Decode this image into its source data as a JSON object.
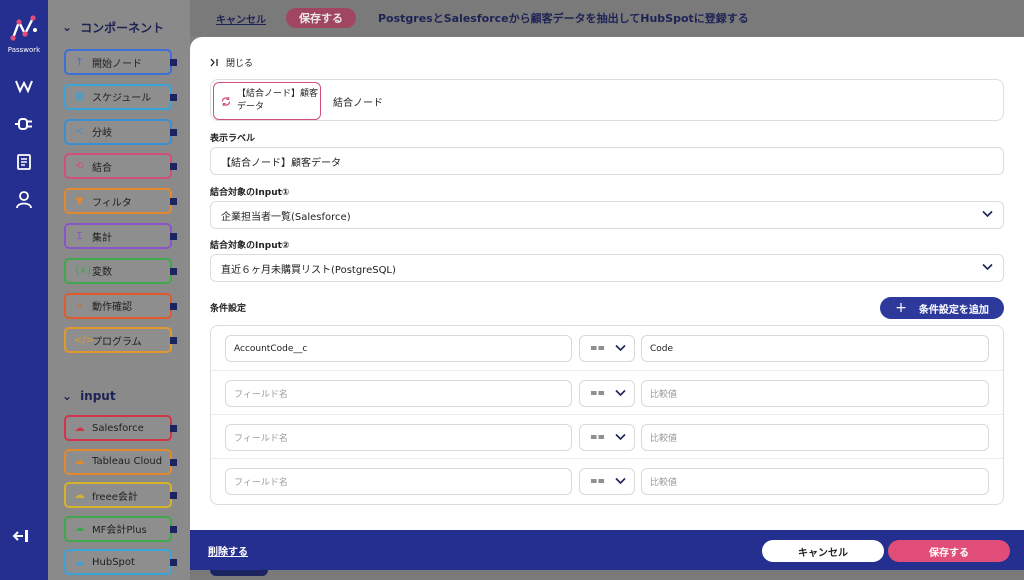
{
  "app": {
    "logo_text": "Passwork"
  },
  "rail": {
    "icons": [
      "workflow-icon",
      "plug-icon",
      "document-icon",
      "user-icon"
    ],
    "exit_icon": "logout-icon"
  },
  "palette": {
    "components_heading": "コンポーネント",
    "components": [
      {
        "label": "開始ノード",
        "icon": "↑",
        "color": "#3d6fd6"
      },
      {
        "label": "スケジュール",
        "icon": "▦",
        "color": "#3aa3d8"
      },
      {
        "label": "分岐",
        "icon": "≺",
        "color": "#3a8fd0"
      },
      {
        "label": "結合",
        "icon": "⟲",
        "color": "#d24f7a"
      },
      {
        "label": "フィルタ",
        "icon": "▼",
        "color": "#e28a2b"
      },
      {
        "label": "集計",
        "icon": "Σ",
        "color": "#8a55c9"
      },
      {
        "label": "変数",
        "icon": "{x}",
        "color": "#3fa84a"
      },
      {
        "label": "動作確認",
        "icon": "⌕",
        "color": "#e05a2e"
      },
      {
        "label": "プログラム",
        "icon": "</>",
        "color": "#e09a2b"
      }
    ],
    "input_heading": "input",
    "inputs": [
      {
        "label": "Salesforce",
        "icon": "☁",
        "color": "#d2354a"
      },
      {
        "label": "Tableau Cloud",
        "icon": "☁",
        "color": "#e28a2b"
      },
      {
        "label": "freee会計",
        "icon": "☁",
        "color": "#d6b32b"
      },
      {
        "label": "MF会計Plus",
        "icon": "☁",
        "color": "#3fa84a"
      },
      {
        "label": "HubSpot",
        "icon": "☁",
        "color": "#3aa3d8"
      }
    ]
  },
  "topbar": {
    "cancel_label": "キャンセル",
    "save_label": "保存する",
    "title": "PostgresとSalesforceから顧客データを抽出してHubSpotに登録する"
  },
  "panel": {
    "close_label": "閉じる",
    "node_chip_text": "【結合ノード】顧客データ",
    "node_type": "結合ノード",
    "display_label_heading": "表示ラベル",
    "display_label_value": "【結合ノード】顧客データ",
    "input1_heading": "結合対象のInput①",
    "input1_value": "企業担当者一覧(Salesforce)",
    "input2_heading": "結合対象のInput②",
    "input2_value": "直近６ヶ月未購買リスト(PostgreSQL)",
    "conditions_heading": "条件設定",
    "add_condition_label": "条件設定を追加",
    "field_placeholder": "フィールド名",
    "value_placeholder": "比較値",
    "conditions": [
      {
        "field": "AccountCode__c",
        "op": "==",
        "value": "Code"
      },
      {
        "field": "",
        "op": "==",
        "value": ""
      },
      {
        "field": "",
        "op": "==",
        "value": ""
      },
      {
        "field": "",
        "op": "==",
        "value": ""
      }
    ]
  },
  "bottombar": {
    "delete_label": "削除する",
    "cancel_label": "キャンセル",
    "save_label": "保存する"
  },
  "colors": {
    "navy": "#252f8f",
    "pink": "#e04d78",
    "add_button": "#2d3a9c"
  }
}
